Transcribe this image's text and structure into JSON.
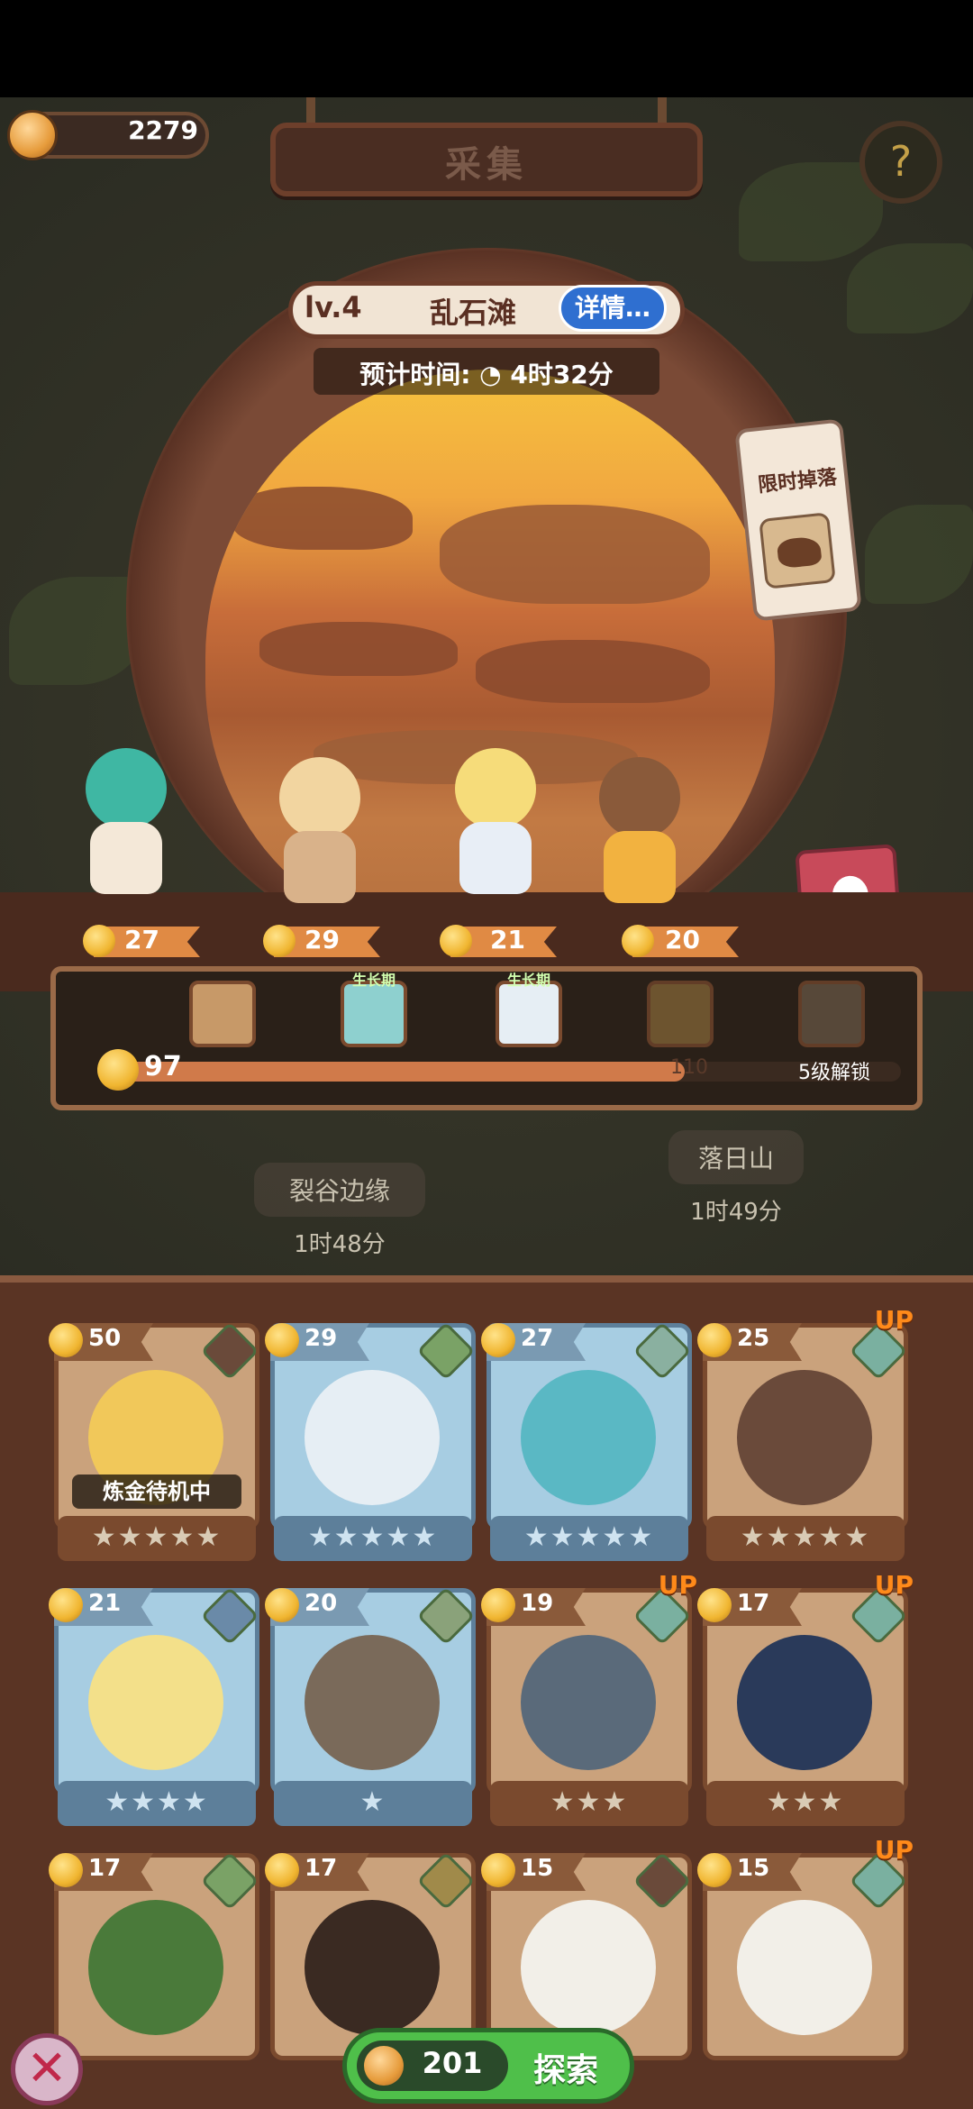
{
  "header": {
    "currency_value": "2279",
    "title": "采集",
    "help_icon": "sprout-question-icon"
  },
  "location": {
    "level": "lv.4",
    "name": "乱石滩",
    "details_label": "详情…",
    "estimated_time_label": "预计时间:",
    "estimated_time_value": "4时32分",
    "limited_drop_label": "限时掉落"
  },
  "team": [
    {
      "level": "27"
    },
    {
      "level": "29"
    },
    {
      "level": "21"
    },
    {
      "level": "20"
    }
  ],
  "resources": {
    "slots": [
      {
        "icon": "ore-icon",
        "badge": ""
      },
      {
        "icon": "pond-icon",
        "badge": "生长期"
      },
      {
        "icon": "crystal-icon",
        "badge": "生长期"
      },
      {
        "icon": "honeycomb-icon",
        "badge": ""
      },
      {
        "icon": "lock-icon",
        "badge": ""
      }
    ],
    "current_value": "97",
    "threshold_value": "110",
    "unlock_text": "5级解锁"
  },
  "nearby_locations": [
    {
      "name": "裂谷边缘",
      "time": "1时48分"
    },
    {
      "name": "落日山",
      "time": "1时49分"
    }
  ],
  "roster": [
    {
      "level": "50",
      "stars": "★★★★★",
      "tag": "炼金待机中",
      "up": ""
    },
    {
      "level": "29",
      "stars": "★★★★★",
      "tag": "",
      "up": ""
    },
    {
      "level": "27",
      "stars": "★★★★★",
      "tag": "",
      "up": ""
    },
    {
      "level": "25",
      "stars": "★★★★★",
      "tag": "",
      "up": "UP"
    },
    {
      "level": "21",
      "stars": "★★★★",
      "tag": "",
      "up": ""
    },
    {
      "level": "20",
      "stars": "★",
      "tag": "",
      "up": ""
    },
    {
      "level": "19",
      "stars": "★★★",
      "tag": "",
      "up": "UP"
    },
    {
      "level": "17",
      "stars": "★★★",
      "tag": "",
      "up": "UP"
    },
    {
      "level": "17",
      "stars": "",
      "tag": "",
      "up": ""
    },
    {
      "level": "17",
      "stars": "",
      "tag": "",
      "up": ""
    },
    {
      "level": "15",
      "stars": "",
      "tag": "",
      "up": ""
    },
    {
      "level": "15",
      "stars": "",
      "tag": "",
      "up": "UP"
    }
  ],
  "bottom": {
    "explore_cost": "201",
    "explore_label": "探索",
    "close_icon": "close-x-icon"
  },
  "colors": {
    "accent_green": "#4fbf4a",
    "wood": "#7a4a2e",
    "selected_blue": "#a7cde2"
  }
}
